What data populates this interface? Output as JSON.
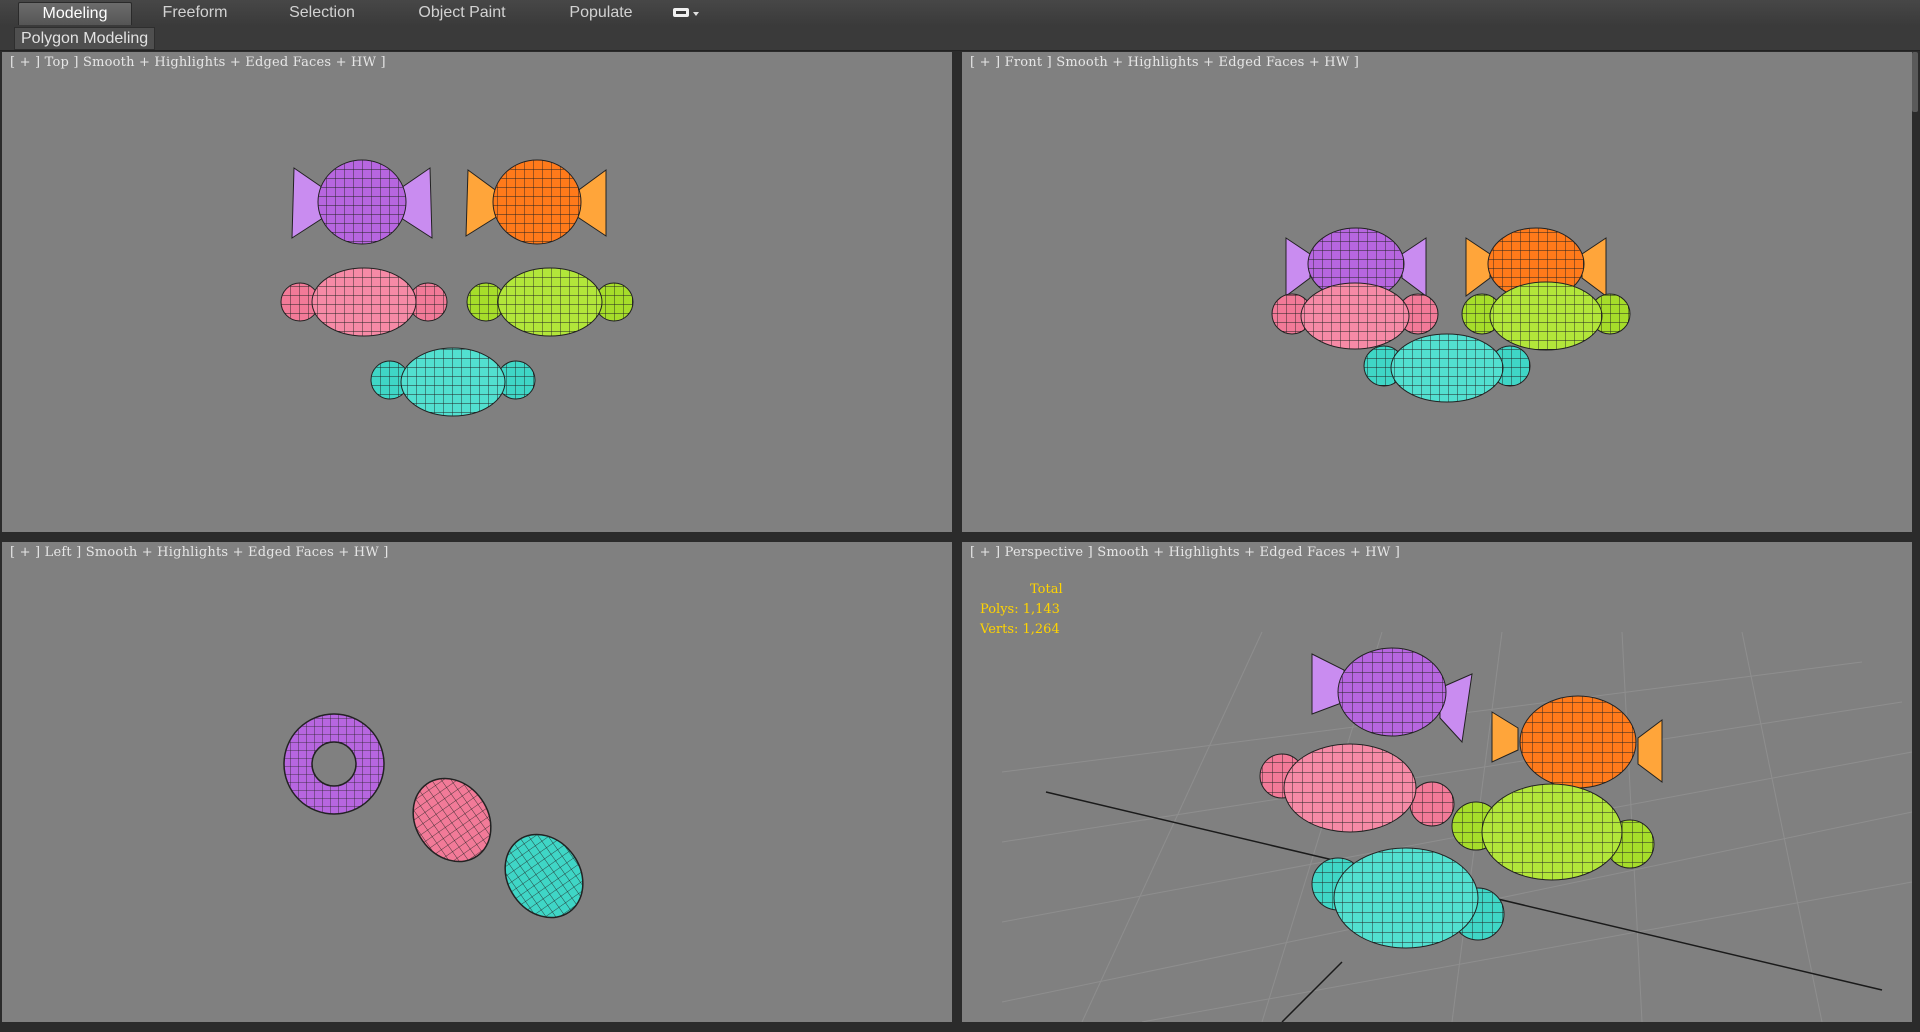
{
  "ribbon": {
    "tabs": [
      "Modeling",
      "Freeform",
      "Selection",
      "Object Paint",
      "Populate"
    ],
    "active_tab": "Modeling",
    "subtab": "Polygon Modeling"
  },
  "viewports": {
    "top": {
      "label": "[ + ] Top ] Smooth + Highlights + Edged Faces + HW ]"
    },
    "front": {
      "label": "[ + ] Front ] Smooth + Highlights + Edged Faces + HW ]"
    },
    "left": {
      "label": "[ + ] Left ] Smooth + Highlights + Edged Faces + HW ]"
    },
    "persp": {
      "label": "[ + ] Perspective ] Smooth + Highlights + Edged Faces + HW ]"
    }
  },
  "stats": {
    "title": "Total",
    "polys": "Polys: 1,143",
    "verts": "Verts: 1,264"
  },
  "colors": {
    "purple": "#b766e0",
    "orange": "#ff7a1a",
    "pink": "#f27a98",
    "green": "#a6dd2a",
    "cyan": "#3fd6c6",
    "viewport_bg": "#808080",
    "stats_text": "#ffd400"
  }
}
